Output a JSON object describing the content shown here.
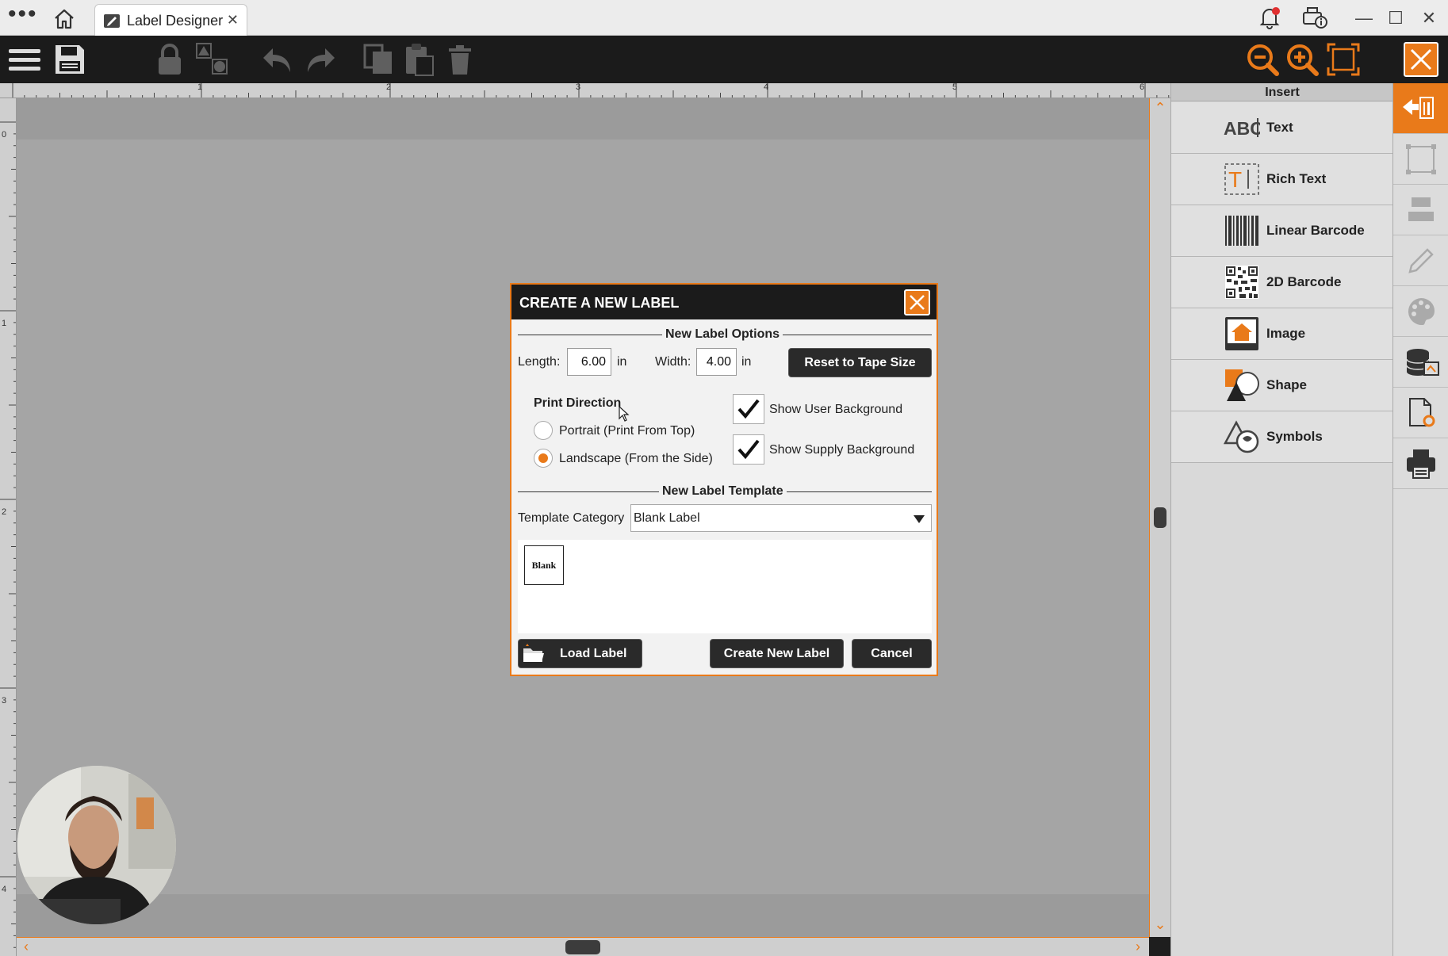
{
  "titlebar": {
    "tab_label": "Label Designer",
    "tab_close": "✕",
    "window_controls": {
      "minimize": "—",
      "maximize": "☐",
      "close": "✕"
    }
  },
  "toolbar": {
    "left_icons": [
      "menu-icon",
      "save-icon",
      "lock-icon",
      "group-icon",
      "undo-icon",
      "redo-icon",
      "copy-icon",
      "paste-icon",
      "delete-icon"
    ],
    "right_icons": [
      "zoom-out-icon",
      "zoom-in-icon",
      "fit-icon",
      "close-designer-icon"
    ]
  },
  "ruler": {
    "top_numbers": [
      "1",
      "2",
      "3",
      "4",
      "5",
      "6"
    ],
    "left_numbers": [
      "0",
      "1",
      "2",
      "3",
      "4"
    ]
  },
  "insert_panel": {
    "title": "Insert",
    "items": [
      {
        "label": "Text",
        "icon": "text-icon"
      },
      {
        "label": "Rich Text",
        "icon": "rich-text-icon"
      },
      {
        "label": "Linear Barcode",
        "icon": "linear-barcode-icon"
      },
      {
        "label": "2D Barcode",
        "icon": "2d-barcode-icon"
      },
      {
        "label": "Image",
        "icon": "image-icon"
      },
      {
        "label": "Shape",
        "icon": "shape-icon"
      },
      {
        "label": "Symbols",
        "icon": "symbols-icon"
      }
    ]
  },
  "dialog": {
    "title": "CREATE A NEW LABEL",
    "options_section": "New Label Options",
    "length_label": "Length:",
    "length_value": "6.00",
    "length_unit": "in",
    "width_label": "Width:",
    "width_value": "4.00",
    "width_unit": "in",
    "reset_button": "Reset to Tape Size",
    "print_direction_label": "Print Direction",
    "portrait_label": "Portrait (Print From Top)",
    "landscape_label": "Landscape (From the Side)",
    "selected_direction": "landscape",
    "show_user_background": "Show User Background",
    "show_supply_background": "Show Supply Background",
    "template_section": "New Label Template",
    "template_category_label": "Template Category",
    "template_category_value": "Blank Label",
    "template_blank_label": "Blank",
    "load_button": "Load Label",
    "create_button": "Create New Label",
    "cancel_button": "Cancel"
  },
  "colors": {
    "accent": "#e97a1a",
    "toolbar_bg": "#1b1b1b",
    "canvas_bg": "#9b9b9b"
  }
}
